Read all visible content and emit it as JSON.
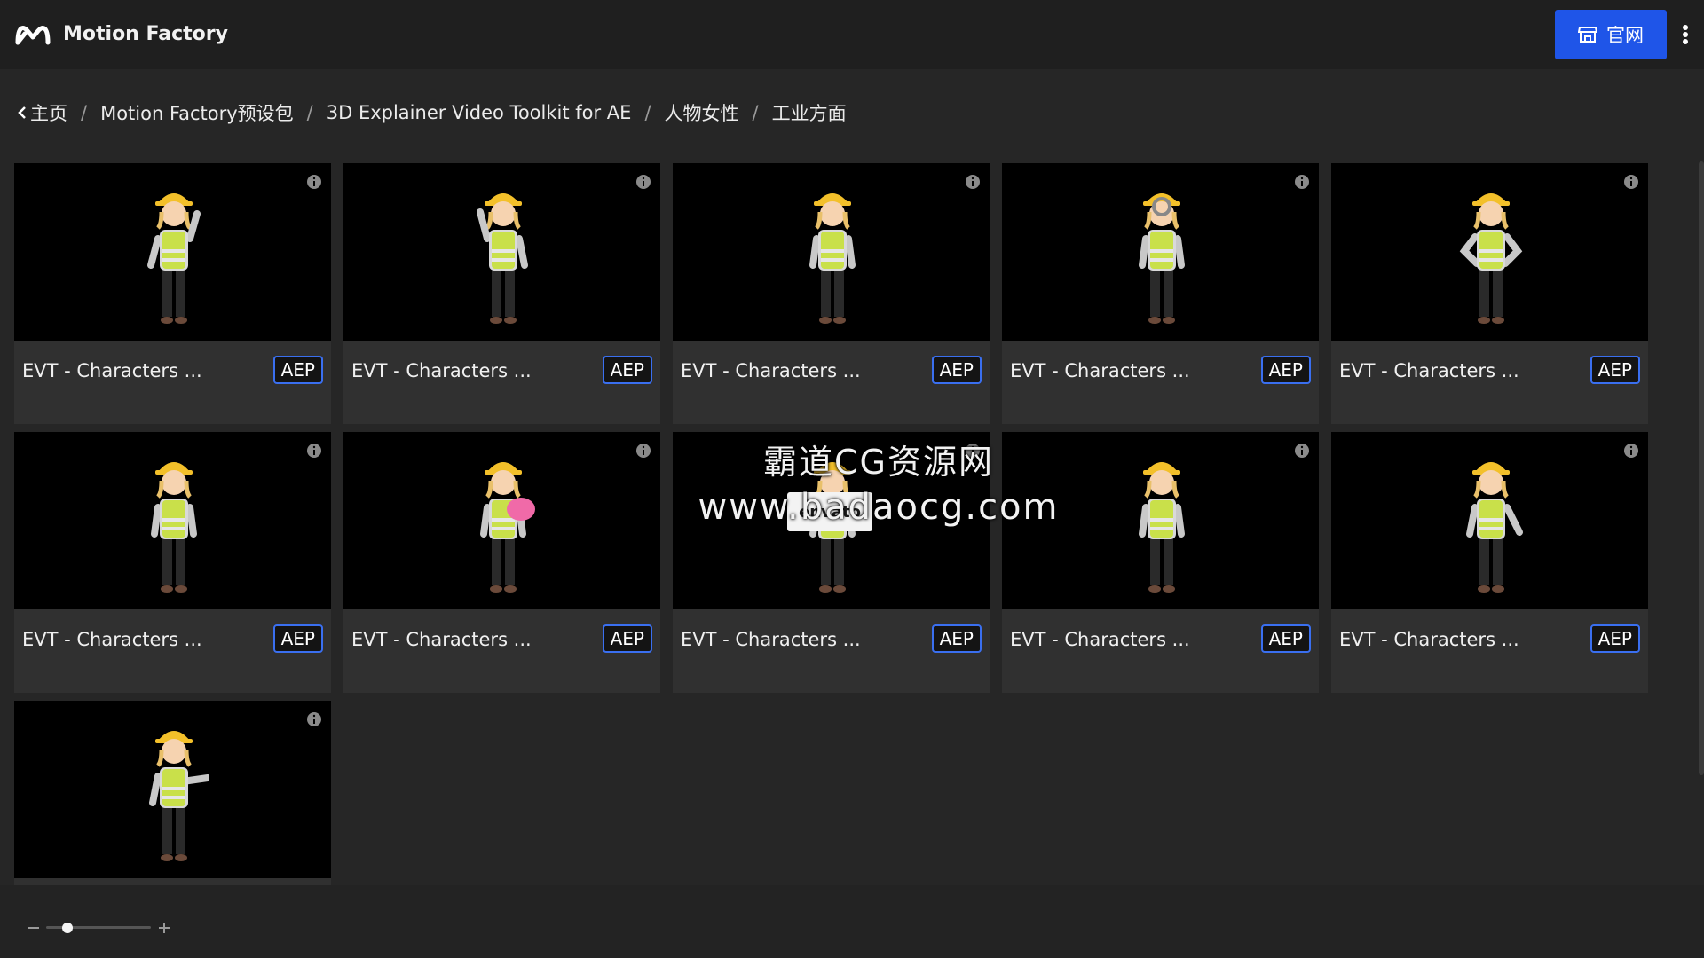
{
  "app": {
    "title": "Motion Factory",
    "site_button_label": "官网"
  },
  "breadcrumb": [
    {
      "label": "主页"
    },
    {
      "label": "Motion Factory预设包"
    },
    {
      "label": "3D Explainer Video Toolkit for AE"
    },
    {
      "label": "人物女性"
    },
    {
      "label": "工业方面"
    }
  ],
  "breadcrumb_separator": "/",
  "cards": [
    {
      "title": "EVT - Characters ...",
      "badge": "AEP",
      "pose": "wave"
    },
    {
      "title": "EVT - Characters ...",
      "badge": "AEP",
      "pose": "wave-left"
    },
    {
      "title": "EVT - Characters ...",
      "badge": "AEP",
      "pose": "thinking"
    },
    {
      "title": "EVT - Characters ...",
      "badge": "AEP",
      "pose": "magnifier"
    },
    {
      "title": "EVT - Characters ...",
      "badge": "AEP",
      "pose": "hands-on-hips"
    },
    {
      "title": "EVT - Characters ...",
      "badge": "AEP",
      "pose": "hands-clasped"
    },
    {
      "title": "EVT - Characters ...",
      "badge": "AEP",
      "pose": "piggy-bank"
    },
    {
      "title": "EVT - Characters ...",
      "badge": "AEP",
      "pose": "holding-sign"
    },
    {
      "title": "EVT - Characters ...",
      "badge": "AEP",
      "pose": "idle"
    },
    {
      "title": "EVT - Characters ...",
      "badge": "AEP",
      "pose": "pointing-down"
    },
    {
      "title": "",
      "badge": "",
      "pose": "pointing-right"
    }
  ],
  "watermark": {
    "line1": "霸道CG资源网",
    "line2": "www.badaocg.com"
  },
  "envato_sign": "envato",
  "zoom": {
    "value": 0.2
  },
  "colors": {
    "accent": "#1f55e8",
    "badge_border": "#3a6ff0",
    "background": "#262626",
    "vest": "#c9e04a",
    "helmet": "#f3c02a"
  }
}
